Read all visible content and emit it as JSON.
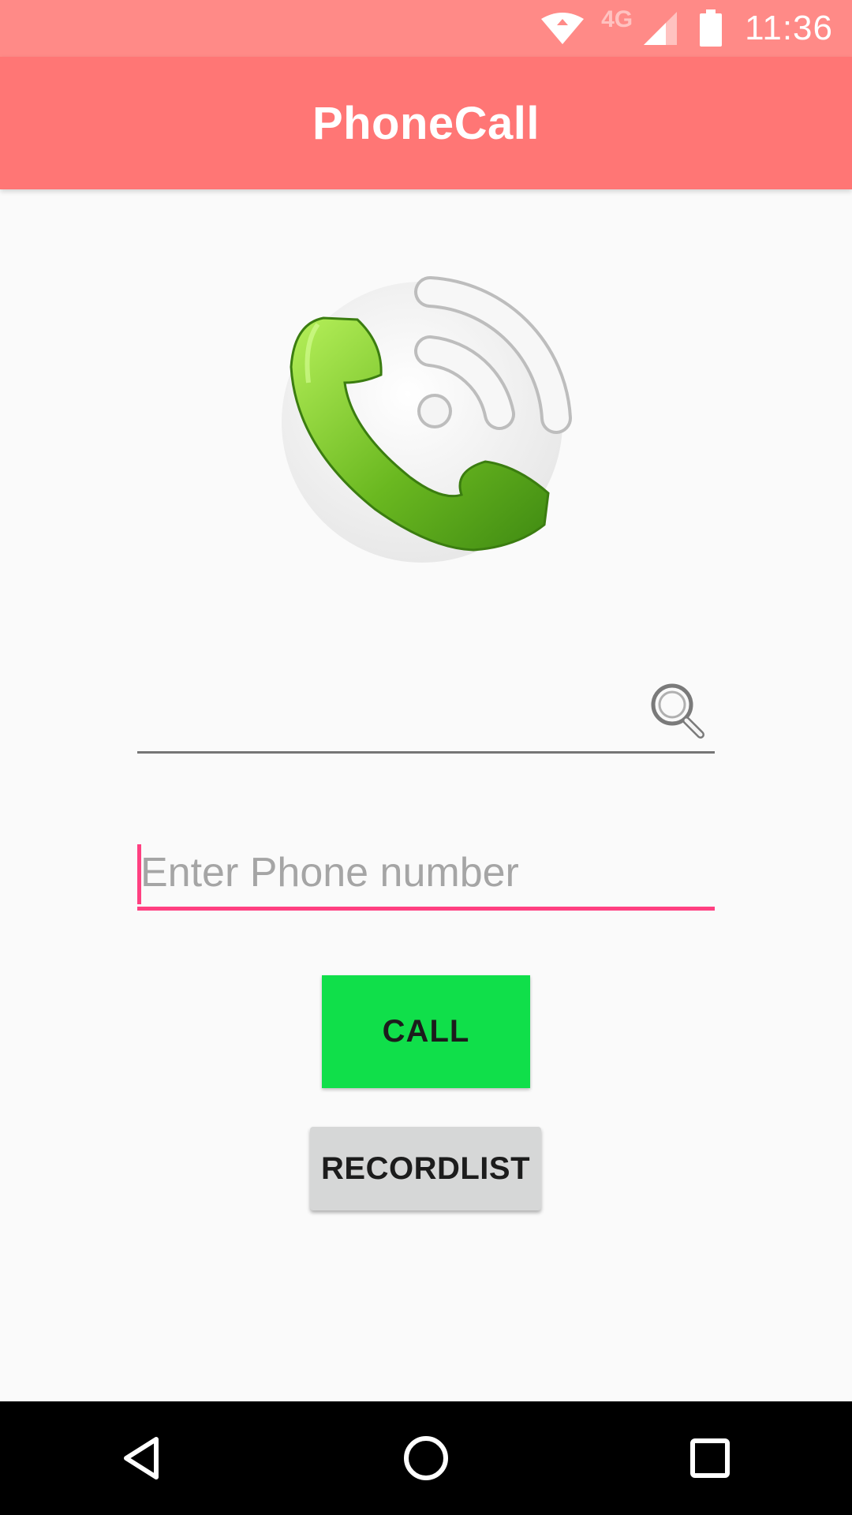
{
  "status_bar": {
    "time": "11:36",
    "network_label": "4G",
    "icons": [
      "wifi-icon",
      "cell-signal-icon",
      "battery-icon"
    ]
  },
  "app_bar": {
    "title": "PhoneCall"
  },
  "logo": {
    "icon": "phone-handset-wave-icon"
  },
  "search": {
    "value": "",
    "icon": "search-icon"
  },
  "phone_input": {
    "value": "",
    "placeholder": "Enter Phone number"
  },
  "buttons": {
    "call_label": "CALL",
    "recordlist_label": "RECORDLIST"
  },
  "nav_bar": {
    "icons": [
      "back-icon",
      "home-icon",
      "recents-icon"
    ]
  },
  "colors": {
    "status_bar": "#ff8a87",
    "app_bar": "#ff7675",
    "accent": "#ff4081",
    "call_button": "#10df4a",
    "secondary_button": "#d6d7d7"
  }
}
